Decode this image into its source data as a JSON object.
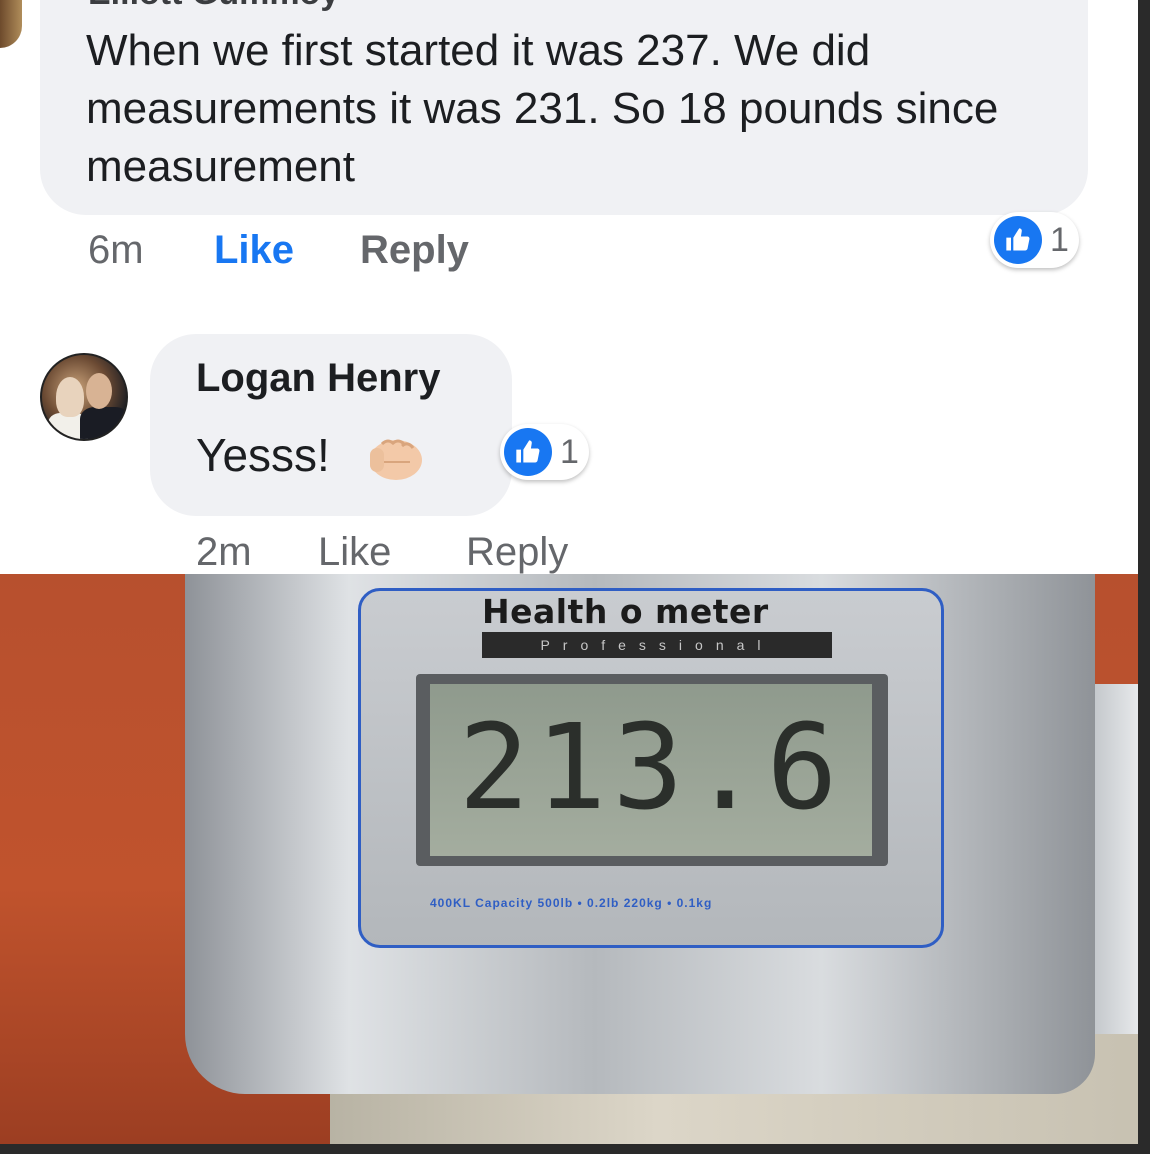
{
  "comment_1": {
    "author_fragment": "Elliott Gummoy",
    "text": "When we first started it was 237. We did measurements it was 231.  So 18 pounds since measurement",
    "time": "6m",
    "like_label": "Like",
    "reply_label": "Reply",
    "reaction_count": "1"
  },
  "comment_2": {
    "author": "Logan Henry",
    "text": "Yesss!",
    "emoji": "fist-bump-emoji",
    "time": "2m",
    "like_label": "Like",
    "reply_label": "Reply",
    "reaction_count": "1"
  },
  "photo": {
    "brand": "Health o meter",
    "tagline": "Professional",
    "reading": "213.6",
    "capacity": "400KL Capacity 500lb • 0.2lb   220kg • 0.1kg"
  },
  "colors": {
    "accent": "#1877f2",
    "bubble": "#f0f1f4",
    "meta": "#65676b"
  }
}
